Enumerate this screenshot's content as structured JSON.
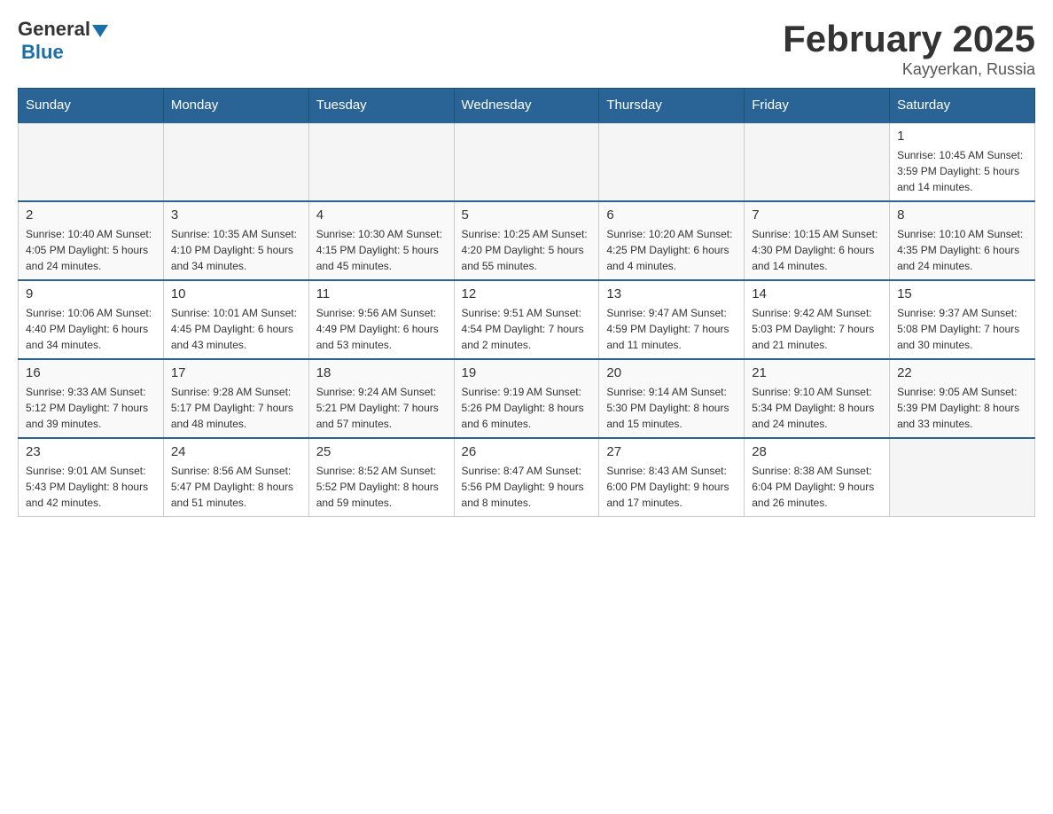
{
  "header": {
    "logo_general": "General",
    "logo_blue": "Blue",
    "title": "February 2025",
    "location": "Kayyerkan, Russia"
  },
  "days_of_week": [
    "Sunday",
    "Monday",
    "Tuesday",
    "Wednesday",
    "Thursday",
    "Friday",
    "Saturday"
  ],
  "weeks": [
    [
      {
        "day": "",
        "info": ""
      },
      {
        "day": "",
        "info": ""
      },
      {
        "day": "",
        "info": ""
      },
      {
        "day": "",
        "info": ""
      },
      {
        "day": "",
        "info": ""
      },
      {
        "day": "",
        "info": ""
      },
      {
        "day": "1",
        "info": "Sunrise: 10:45 AM\nSunset: 3:59 PM\nDaylight: 5 hours\nand 14 minutes."
      }
    ],
    [
      {
        "day": "2",
        "info": "Sunrise: 10:40 AM\nSunset: 4:05 PM\nDaylight: 5 hours\nand 24 minutes."
      },
      {
        "day": "3",
        "info": "Sunrise: 10:35 AM\nSunset: 4:10 PM\nDaylight: 5 hours\nand 34 minutes."
      },
      {
        "day": "4",
        "info": "Sunrise: 10:30 AM\nSunset: 4:15 PM\nDaylight: 5 hours\nand 45 minutes."
      },
      {
        "day": "5",
        "info": "Sunrise: 10:25 AM\nSunset: 4:20 PM\nDaylight: 5 hours\nand 55 minutes."
      },
      {
        "day": "6",
        "info": "Sunrise: 10:20 AM\nSunset: 4:25 PM\nDaylight: 6 hours\nand 4 minutes."
      },
      {
        "day": "7",
        "info": "Sunrise: 10:15 AM\nSunset: 4:30 PM\nDaylight: 6 hours\nand 14 minutes."
      },
      {
        "day": "8",
        "info": "Sunrise: 10:10 AM\nSunset: 4:35 PM\nDaylight: 6 hours\nand 24 minutes."
      }
    ],
    [
      {
        "day": "9",
        "info": "Sunrise: 10:06 AM\nSunset: 4:40 PM\nDaylight: 6 hours\nand 34 minutes."
      },
      {
        "day": "10",
        "info": "Sunrise: 10:01 AM\nSunset: 4:45 PM\nDaylight: 6 hours\nand 43 minutes."
      },
      {
        "day": "11",
        "info": "Sunrise: 9:56 AM\nSunset: 4:49 PM\nDaylight: 6 hours\nand 53 minutes."
      },
      {
        "day": "12",
        "info": "Sunrise: 9:51 AM\nSunset: 4:54 PM\nDaylight: 7 hours\nand 2 minutes."
      },
      {
        "day": "13",
        "info": "Sunrise: 9:47 AM\nSunset: 4:59 PM\nDaylight: 7 hours\nand 11 minutes."
      },
      {
        "day": "14",
        "info": "Sunrise: 9:42 AM\nSunset: 5:03 PM\nDaylight: 7 hours\nand 21 minutes."
      },
      {
        "day": "15",
        "info": "Sunrise: 9:37 AM\nSunset: 5:08 PM\nDaylight: 7 hours\nand 30 minutes."
      }
    ],
    [
      {
        "day": "16",
        "info": "Sunrise: 9:33 AM\nSunset: 5:12 PM\nDaylight: 7 hours\nand 39 minutes."
      },
      {
        "day": "17",
        "info": "Sunrise: 9:28 AM\nSunset: 5:17 PM\nDaylight: 7 hours\nand 48 minutes."
      },
      {
        "day": "18",
        "info": "Sunrise: 9:24 AM\nSunset: 5:21 PM\nDaylight: 7 hours\nand 57 minutes."
      },
      {
        "day": "19",
        "info": "Sunrise: 9:19 AM\nSunset: 5:26 PM\nDaylight: 8 hours\nand 6 minutes."
      },
      {
        "day": "20",
        "info": "Sunrise: 9:14 AM\nSunset: 5:30 PM\nDaylight: 8 hours\nand 15 minutes."
      },
      {
        "day": "21",
        "info": "Sunrise: 9:10 AM\nSunset: 5:34 PM\nDaylight: 8 hours\nand 24 minutes."
      },
      {
        "day": "22",
        "info": "Sunrise: 9:05 AM\nSunset: 5:39 PM\nDaylight: 8 hours\nand 33 minutes."
      }
    ],
    [
      {
        "day": "23",
        "info": "Sunrise: 9:01 AM\nSunset: 5:43 PM\nDaylight: 8 hours\nand 42 minutes."
      },
      {
        "day": "24",
        "info": "Sunrise: 8:56 AM\nSunset: 5:47 PM\nDaylight: 8 hours\nand 51 minutes."
      },
      {
        "day": "25",
        "info": "Sunrise: 8:52 AM\nSunset: 5:52 PM\nDaylight: 8 hours\nand 59 minutes."
      },
      {
        "day": "26",
        "info": "Sunrise: 8:47 AM\nSunset: 5:56 PM\nDaylight: 9 hours\nand 8 minutes."
      },
      {
        "day": "27",
        "info": "Sunrise: 8:43 AM\nSunset: 6:00 PM\nDaylight: 9 hours\nand 17 minutes."
      },
      {
        "day": "28",
        "info": "Sunrise: 8:38 AM\nSunset: 6:04 PM\nDaylight: 9 hours\nand 26 minutes."
      },
      {
        "day": "",
        "info": ""
      }
    ]
  ]
}
